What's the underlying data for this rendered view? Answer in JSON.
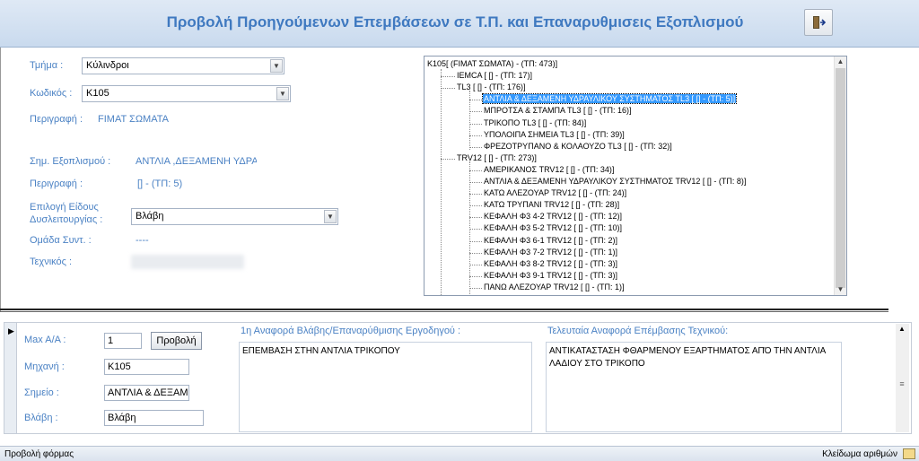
{
  "header": {
    "title": "Προβολή Προηγούμενων Επεμβάσεων σε Τ.Π. και Επαναρυθμισεις Εξοπλισμού"
  },
  "form": {
    "tmima_label": "Τμήμα :",
    "tmima_value": "Κύλινδροι",
    "kodikos_label": "Κωδικός :",
    "kodikos_value": "K105",
    "perigrafi_label": "Περιγραφή :",
    "perigrafi_value": "FIMAT ΣΩΜΑΤΑ",
    "simeio_label": "Σημ. Εξοπλισμού :",
    "simeio_value": "ΑΝΤΛΙΑ ,ΔΕΞΑΜΕΝΗ ΥΔΡΑΥ",
    "perigrafi2_label": "Περιγραφή :",
    "perigrafi2_value": "[] - (ΤΠ: 5)",
    "epilogi_label_1": "Επιλογή Είδους",
    "epilogi_label_2": "Δυσλειτουργίας :",
    "epilogi_value": "Βλάβη",
    "omada_label": "Ομάδα Συντ. :",
    "omada_value": "----",
    "texnikos_label": "Τεχνικός :"
  },
  "tree": {
    "nodes": [
      {
        "text": "K105[ (FIMAT ΣΩΜΑΤΑ) - (ΤΠ: 473)]",
        "level": 0,
        "selected": false
      },
      {
        "text": "IEMCA [ [] - (ΤΠ: 17)]",
        "level": 1,
        "selected": false
      },
      {
        "text": "TL3 [ [] - (ΤΠ: 176)]",
        "level": 1,
        "selected": false
      },
      {
        "text": "ΑΝΤΛΙΑ & ΔΕΞΑΜΕΝΗ ΥΔΡΑΥΛΙΚΟΥ ΣΥΣΤΗΜΑΤΟΣ TL3 [ [] - (ΤΠ: 5)]",
        "level": 2,
        "selected": true
      },
      {
        "text": "ΜΠΡΟΤΣΑ & ΣΤΑΜΠΑ TL3 [ [] - (ΤΠ: 16)]",
        "level": 2,
        "selected": false
      },
      {
        "text": "ΤΡΙΚΟΠΟ TL3 [ [] - (ΤΠ: 84)]",
        "level": 2,
        "selected": false
      },
      {
        "text": "ΥΠΟΛΟΙΠΑ ΣΗΜΕΙΑ TL3 [ [] - (ΤΠ: 39)]",
        "level": 2,
        "selected": false
      },
      {
        "text": "ΦΡΕΖΟΤΡΥΠΑΝΟ & ΚΟΛΑΟΥΖΟ TL3 [ [] - (ΤΠ: 32)]",
        "level": 2,
        "selected": false
      },
      {
        "text": "TRV12 [ [] - (ΤΠ: 273)]",
        "level": 1,
        "selected": false
      },
      {
        "text": "ΑΜΕΡΙΚΑΝΟΣ TRV12 [ [] - (ΤΠ: 34)]",
        "level": 2,
        "selected": false
      },
      {
        "text": "ΑΝΤΛΙΑ & ΔΕΞΑΜΕΝΗ ΥΔΡΑΥΛΙΚΟΥ ΣΥΣΤΗΜΑΤΟΣ TRV12 [ [] - (ΤΠ: 8)]",
        "level": 2,
        "selected": false
      },
      {
        "text": "ΚΑΤΩ ΑΛΕΖΟΥΑΡ TRV12 [ [] - (ΤΠ: 24)]",
        "level": 2,
        "selected": false
      },
      {
        "text": "ΚΑΤΩ ΤΡΥΠΑΝΙ TRV12 [ [] - (ΤΠ: 28)]",
        "level": 2,
        "selected": false
      },
      {
        "text": "ΚΕΦΑΛΗ Φ3 4-2 TRV12 [ [] - (ΤΠ: 12)]",
        "level": 2,
        "selected": false
      },
      {
        "text": "ΚΕΦΑΛΗ Φ3 5-2 TRV12 [ [] - (ΤΠ: 10)]",
        "level": 2,
        "selected": false
      },
      {
        "text": "ΚΕΦΑΛΗ Φ3 6-1 TRV12 [ [] - (ΤΠ: 2)]",
        "level": 2,
        "selected": false
      },
      {
        "text": "ΚΕΦΑΛΗ Φ3 7-2 TRV12 [ [] - (ΤΠ: 1)]",
        "level": 2,
        "selected": false
      },
      {
        "text": "ΚΕΦΑΛΗ Φ3 8-2 TRV12 [ [] - (ΤΠ: 3)]",
        "level": 2,
        "selected": false
      },
      {
        "text": "ΚΕΦΑΛΗ Φ3 9-1 TRV12 [ [] - (ΤΠ: 3)]",
        "level": 2,
        "selected": false
      },
      {
        "text": "ΠΑΝΩ ΑΛΕΖΟΥΑΡ TRV12 [ [] - (ΤΠ: 1)]",
        "level": 2,
        "selected": false
      }
    ]
  },
  "subform": {
    "max_label": "Max A/A :",
    "max_value": "1",
    "view_button": "Προβολή",
    "mixani_label": "Μηχανή :",
    "mixani_value": "K105",
    "simeio_label": "Σημείο :",
    "simeio_value": "ΑΝΤΛΙΑ & ΔΕΞΑΜ",
    "vlavi_label": "Βλάβη :",
    "vlavi_value": "Βλάβη",
    "first_report_label": "1η Αναφορά Βλάβης/Επαναρύθμισης Εργοδηγού :",
    "first_report_text": "ΕΠΕΜΒΑΣΗ ΣΤΗΝ ΑΝΤΛΙΑ ΤΡΙΚΟΠΟΥ",
    "last_report_label": "Τελευταία Αναφορά Επέμβασης Τεχνικού:",
    "last_report_text": "ΑΝΤΙΚΑΤΑΣΤΑΣΗ ΦΘΑΡΜΕΝΟΥ ΕΞΑΡΤΗΜΑΤΟΣ ΑΠΌ ΤΗΝ ΑΝΤΛΙΑ ΛΑΔΙΟΥ ΣΤΟ ΤΡΙΚΟΠΟ"
  },
  "status": {
    "left": "Προβολή φόρμας",
    "right": "Κλείδωμα αριθμών"
  },
  "colors": {
    "accent": "#4b82c4",
    "title": "#3f79c0",
    "selection": "#3399ff"
  }
}
